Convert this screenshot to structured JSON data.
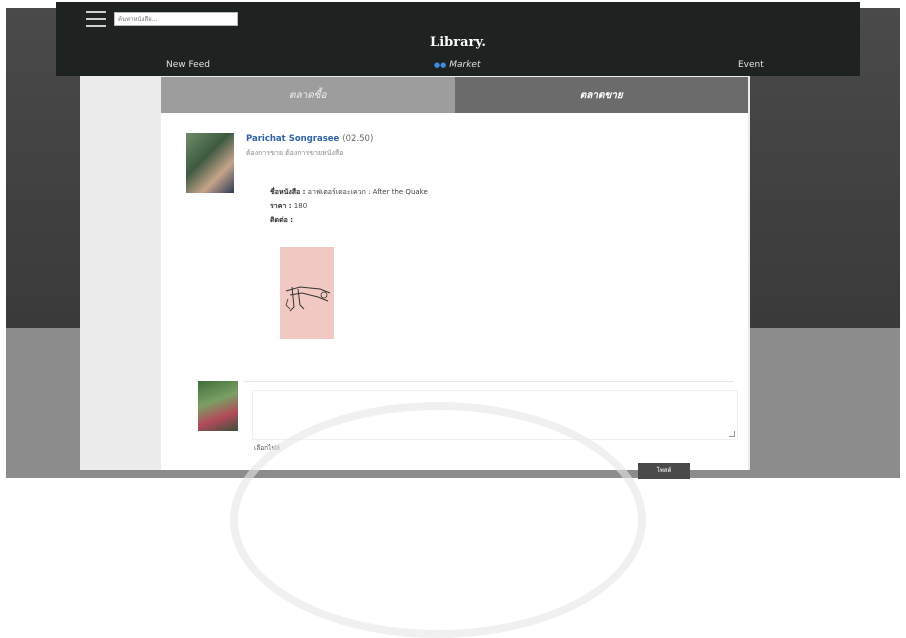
{
  "header": {
    "search_placeholder": "ค้นหาหนังสือ...",
    "brand": "Library."
  },
  "nav": {
    "new_feed": "New Feed",
    "market": "Market",
    "event": "Event"
  },
  "tabs": {
    "buy": "ตลาดซื้อ",
    "sell": "ตลาดขาย"
  },
  "post": {
    "author": "Parichat Songrasee",
    "time": "(02.50)",
    "subtitle": "ต้องการขาย ต้องการขายหนังสือ",
    "book_label": "ชื่อหนังสือ :",
    "book_value": "อาฟเตอร์เดอะเควก : After the Quake",
    "price_label": "ราคา :",
    "price_value": "180",
    "contact_label": "ติดต่อ :",
    "contact_value": ""
  },
  "comment": {
    "choose_file": "เลือกไฟล์",
    "send_label": "โพสต์"
  }
}
